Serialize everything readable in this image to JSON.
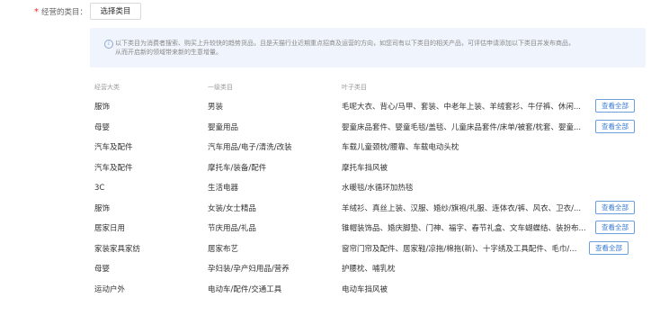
{
  "form": {
    "required_mark": "*",
    "label": "经营的类目：",
    "select_button": "选择类目"
  },
  "notice": {
    "icon": "info-icon",
    "lines": [
      "以下类目为消费者搜索、购买上升较快的趋势货品，且是天猫行业近期重点招商及运营的方向，如您司有以下类目的相关产品，可评估申请添加以下类目并发布商品，",
      "从而开启新的领域带来新的生意增量。"
    ]
  },
  "table": {
    "headers": [
      "经营大类",
      "一级类目",
      "叶子类目"
    ],
    "view_all_label": "查看全部",
    "rows": [
      {
        "major": "服饰",
        "level1": "男装",
        "leaf": "毛呢大衣、背心/马甲、套装、中老年上装、羊绒套衫、牛仔裤、休闲...",
        "view_all": true
      },
      {
        "major": "母婴",
        "level1": "婴童用品",
        "leaf": "婴童床品套件、婴童毛毯/盖毯、儿童床品套件/床单/被套/枕套、婴童...",
        "view_all": true
      },
      {
        "major": "汽车及配件",
        "level1": "汽车用品/电子/清洗/改装",
        "leaf": "车载儿童颈枕/腰靠、车载电动头枕",
        "view_all": false
      },
      {
        "major": "汽车及配件",
        "level1": "摩托车/装备/配件",
        "leaf": "摩托车挡风被",
        "view_all": false
      },
      {
        "major": "3C",
        "level1": "生活电器",
        "leaf": "水暖毯/水循环加热毯",
        "view_all": false
      },
      {
        "major": "服饰",
        "level1": "女装/女士精品",
        "leaf": "羊绒衫、真丝上装、汉服、婚纱/旗袍/礼服、连体衣/裤、风衣、卫衣/...",
        "view_all": true
      },
      {
        "major": "居家日用",
        "level1": "节庆用品/礼品",
        "leaf": "锥帽装饰品、婚庆脚垫、门神、福字、春节礼盒、文车蝴蝶结、装扮布...",
        "view_all": true
      },
      {
        "major": "家装家具家纺",
        "level1": "居家布艺",
        "leaf": "窗帘门帘及配件、居家鞋/凉拖/棉拖(新)、十字绣及工具配件、毛巾/...",
        "view_all": true
      },
      {
        "major": "母婴",
        "level1": "孕妇装/孕产妇用品/营养",
        "leaf": "护腰枕、哺乳枕",
        "view_all": false
      },
      {
        "major": "运动户外",
        "level1": "电动车/配件/交通工具",
        "leaf": "电动车挡风被",
        "view_all": false
      }
    ]
  },
  "colors": {
    "required": "#f5222d",
    "notice_bg": "#f0f5fd",
    "link_blue": "#3a7bd5"
  }
}
